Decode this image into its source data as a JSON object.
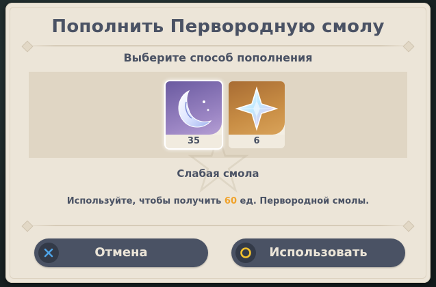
{
  "dialog": {
    "title": "Пополнить Первородную смолу",
    "subtitle": "Выберите способ пополнения"
  },
  "items": [
    {
      "count": "35",
      "icon": "fragile-resin-moon-icon",
      "selected": true
    },
    {
      "count": "6",
      "icon": "primogem-icon",
      "selected": false
    }
  ],
  "selected_item": {
    "name": "Слабая смола"
  },
  "description": {
    "prefix": "Используйте, чтобы получить",
    "amount": "60",
    "suffix": "ед. Первородной смолы."
  },
  "buttons": {
    "cancel": {
      "label": "Отмена",
      "icon": "cross-icon",
      "icon_color": "#4ea3e6"
    },
    "use": {
      "label": "Использовать",
      "icon": "circle-icon",
      "icon_color": "#f2c12e"
    }
  },
  "colors": {
    "accent": "#f0a22a",
    "text": "#4a5264",
    "background": "#ece5d8"
  }
}
